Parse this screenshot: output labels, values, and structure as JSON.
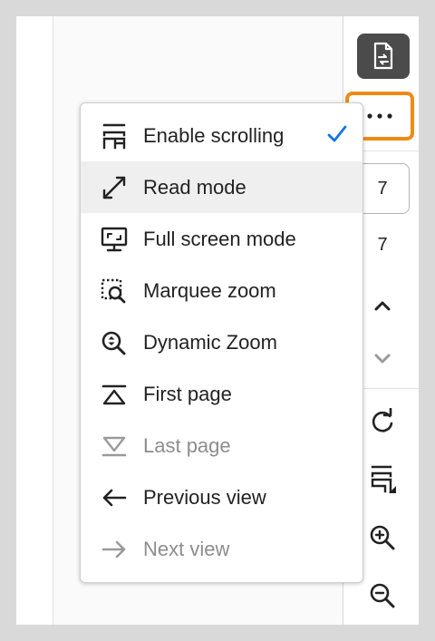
{
  "toolbar": {
    "current_page": "7",
    "total_pages": "7"
  },
  "menu": {
    "items": [
      {
        "label": "Enable scrolling",
        "icon": "enable-scrolling-icon",
        "checked": true,
        "disabled": false
      },
      {
        "label": "Read mode",
        "icon": "read-mode-expand-icon",
        "checked": false,
        "disabled": false
      },
      {
        "label": "Full screen mode",
        "icon": "full-screen-icon",
        "checked": false,
        "disabled": false
      },
      {
        "label": "Marquee zoom",
        "icon": "marquee-zoom-icon",
        "checked": false,
        "disabled": false
      },
      {
        "label": "Dynamic Zoom",
        "icon": "dynamic-zoom-icon",
        "checked": false,
        "disabled": false
      },
      {
        "label": "First page",
        "icon": "first-page-icon",
        "checked": false,
        "disabled": false
      },
      {
        "label": "Last page",
        "icon": "last-page-icon",
        "checked": false,
        "disabled": true
      },
      {
        "label": "Previous view",
        "icon": "arrow-left-icon",
        "checked": false,
        "disabled": false
      },
      {
        "label": "Next view",
        "icon": "arrow-right-icon",
        "checked": false,
        "disabled": true
      }
    ]
  },
  "colors": {
    "accent_check": "#1473e6",
    "highlight_outline": "#f08a12",
    "doc_button_bg": "#4b4b4b",
    "disabled_text": "#8d8d8d"
  }
}
